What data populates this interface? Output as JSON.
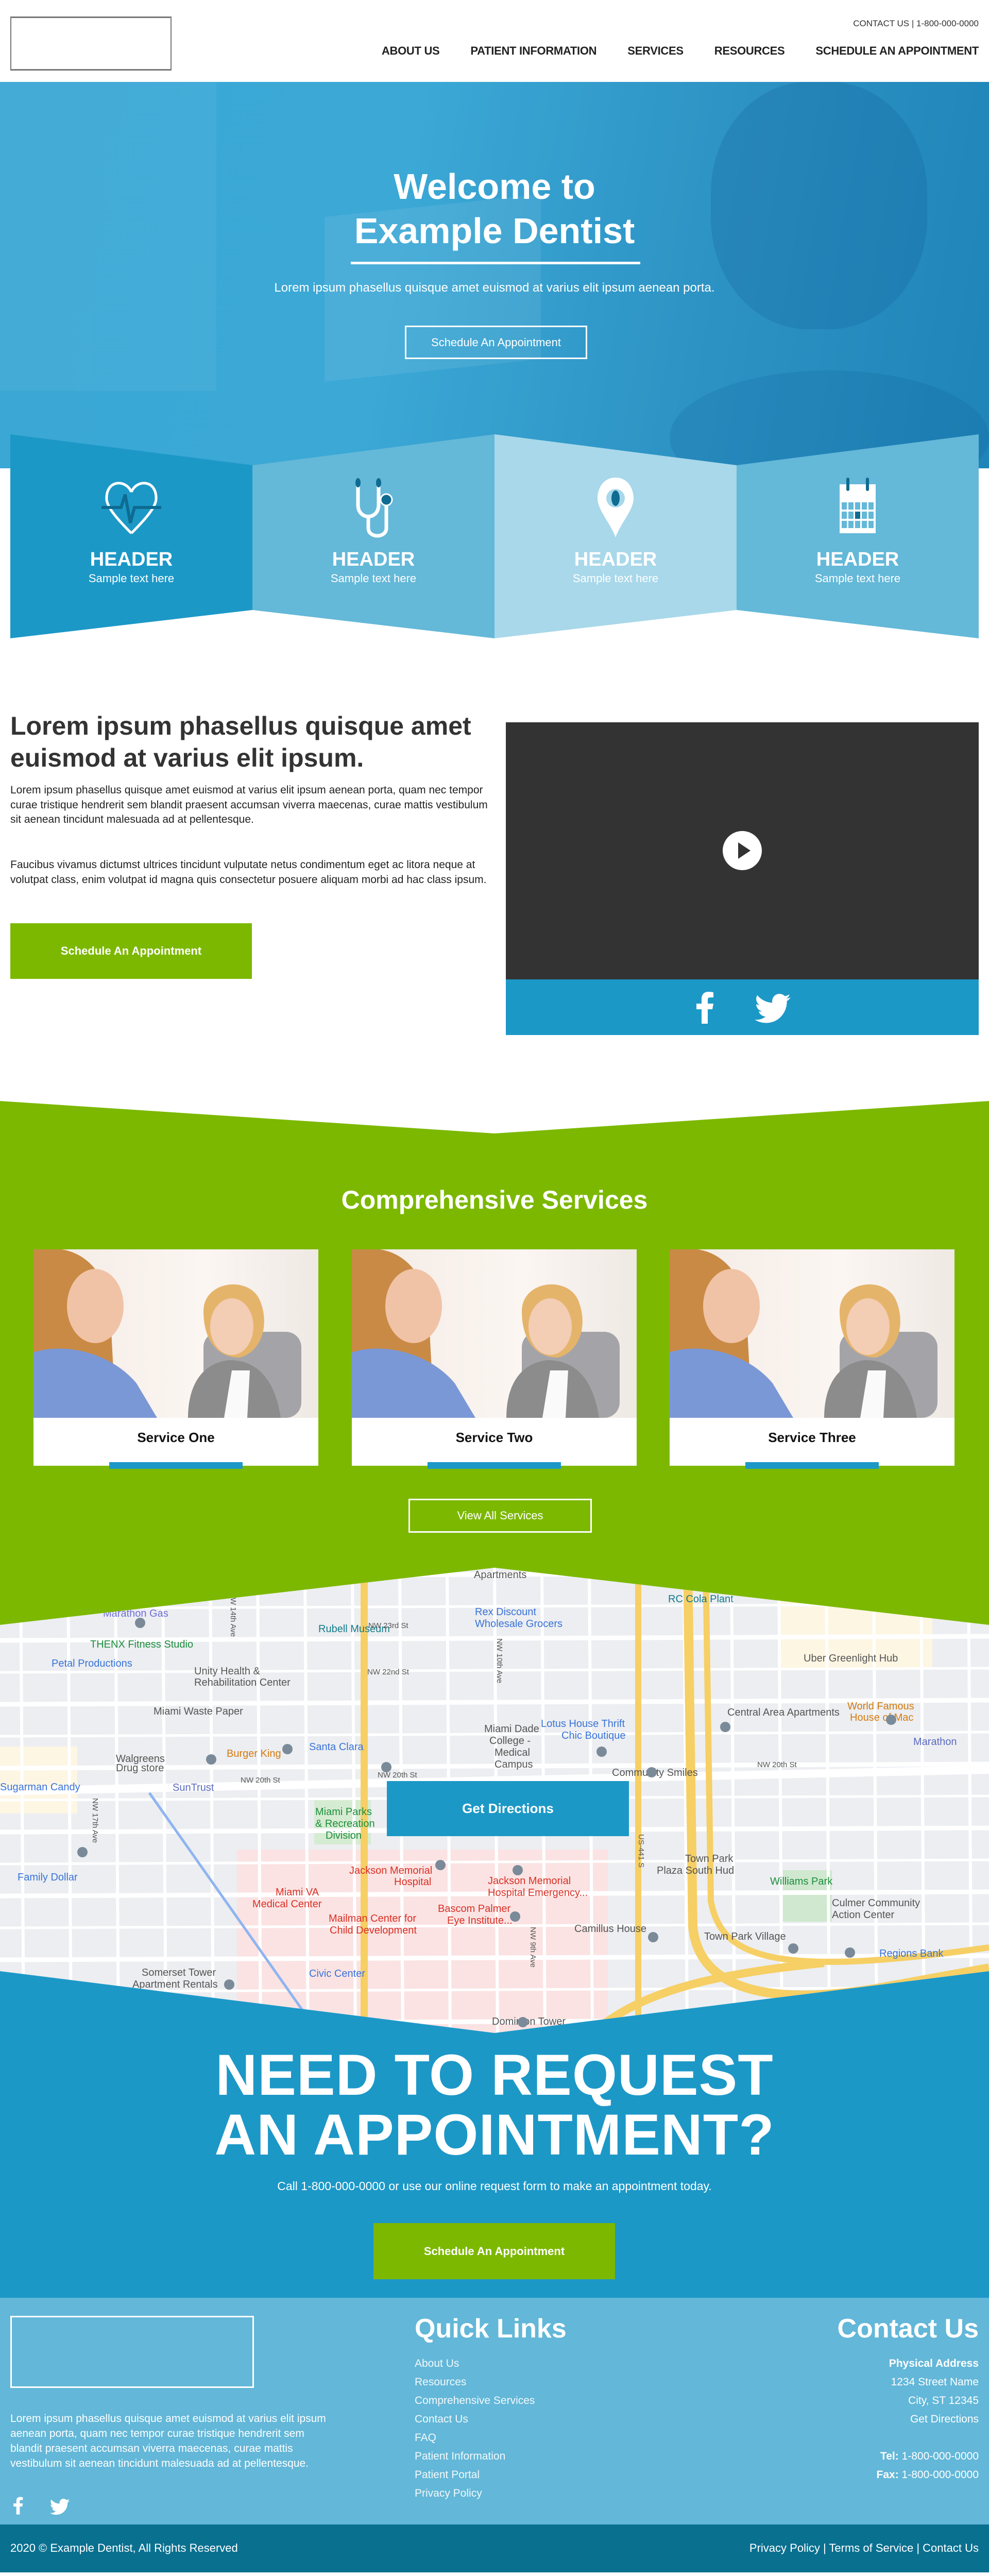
{
  "header": {
    "contact_link": "CONTACT US",
    "phone": "1-800-000-0000",
    "nav": [
      "ABOUT US",
      "PATIENT INFORMATION",
      "SERVICES",
      "RESOURCES",
      "SCHEDULE AN APPOINTMENT"
    ]
  },
  "hero": {
    "title_line1": "Welcome to",
    "title_line2": "Example Dentist",
    "subtitle": "Lorem ipsum phasellus quisque amet euismod at varius elit ipsum aenean porta.",
    "button": "Schedule An Appointment"
  },
  "features": [
    {
      "icon": "heartbeat-icon",
      "header": "HEADER",
      "text": "Sample text here",
      "color": "#1c98c7"
    },
    {
      "icon": "stethoscope-icon",
      "header": "HEADER",
      "text": "Sample text here",
      "color": "#64b8d8"
    },
    {
      "icon": "map-pin-icon",
      "header": "HEADER",
      "text": "Sample text here",
      "color": "#a8d8ea"
    },
    {
      "icon": "calendar-icon",
      "header": "HEADER",
      "text": "Sample text here",
      "color": "#64b8d8"
    }
  ],
  "intro": {
    "heading": "Lorem ipsum phasellus quisque amet euismod at varius elit ipsum.",
    "para1": "Lorem ipsum phasellus quisque amet euismod at varius elit ipsum aenean porta, quam nec tempor curae tristique hendrerit sem blandit praesent accumsan viverra maecenas, curae mattis vestibulum sit aenean tincidunt malesuada ad at pellentesque.",
    "para2": "Faucibus vivamus dictumst ultrices tincidunt vulputate netus condimentum eget ac litora neque at volutpat class, enim volutpat id magna quis consectetur posuere aliquam morbi ad hac class ipsum.",
    "button": "Schedule An Appointment"
  },
  "services": {
    "title": "Comprehensive Services",
    "cards": [
      "Service One",
      "Service Two",
      "Service Three"
    ],
    "button": "View All Services"
  },
  "map": {
    "button": "Get Directions",
    "labels": [
      "Apartments",
      "Marathon Gas",
      "THENX Fitness Studio",
      "Petal Productions",
      "Unity Health &",
      "Rehabilitation Center",
      "Rubell Museum",
      "Rex Discount",
      "Wholesale Grocers",
      "RC Cola Plant",
      "Uber Greenlight Hub",
      "Miami Waste Paper",
      "Burger King",
      "Santa Clara",
      "Miami Dade",
      "College -",
      "Medical",
      "Campus",
      "Lotus House Thrift",
      "Chic Boutique",
      "Central Area Apartments",
      "World Famous",
      "House of Mac",
      "Walgreens",
      "Drug store",
      "SunTrust",
      "Community Smiles",
      "Sugarman Candy",
      "Miami Parks",
      "& Recreation",
      "Division",
      "Jackson Memorial",
      "Hospital",
      "Miami VA",
      "Medical Center",
      "Jackson Memorial",
      "Hospital Emergency...",
      "Bascom Palmer",
      "Eye Institute...",
      "Mailman Center for",
      "Child Development",
      "Town Park",
      "Plaza South Hud",
      "Williams Park",
      "Culmer Community",
      "Action Center",
      "Camillus House",
      "Town Park Village",
      "Regions Bank",
      "Family Dollar",
      "Civic Center",
      "Somerset Tower",
      "Apartment Rentals",
      "Dominion Tower",
      "Marathon",
      "NW 20th St",
      "NW 20th St",
      "NW 20th St",
      "NW 22nd St",
      "NW 23rd St",
      "NW 10th Ave",
      "NW 14th Ave",
      "US-441 S",
      "NW 17th Ave",
      "NW 9th Ave"
    ]
  },
  "cta": {
    "title_line1": "NEED TO REQUEST",
    "title_line2": "AN APPOINTMENT?",
    "subtitle": "Call 1-800-000-0000 or use our online request form to make an appointment today.",
    "button": "Schedule An Appointment"
  },
  "footer": {
    "about": "Lorem ipsum phasellus quisque amet euismod at varius elit ipsum aenean porta, quam nec tempor curae tristique hendrerit sem blandit praesent accumsan viverra maecenas, curae mattis vestibulum sit aenean tincidunt malesuada ad at pellentesque.",
    "quick_links_title": "Quick Links",
    "quick_links": [
      "About Us",
      "Resources",
      "Comprehensive Services",
      "Contact Us",
      "FAQ",
      "Patient Information",
      "Patient Portal",
      "Privacy Policy"
    ],
    "contact_title": "Contact Us",
    "address_label": "Physical Address",
    "street": "1234 Street Name",
    "city": "City, ST 12345",
    "directions": "Get Directions",
    "tel_label": "Tel:",
    "tel": "1-800-000-0000",
    "fax_label": "Fax:",
    "fax": "1-800-000-0000",
    "copyright": "2020  © Example Dentist, All Rights Reserved",
    "legal": [
      "Privacy Policy",
      "Terms of Service",
      "Contact Us"
    ]
  },
  "colors": {
    "blue": "#1c98c7",
    "light_blue": "#63b7d8",
    "green": "#7cb800",
    "dark_blue": "#0a7090",
    "dark": "#333333"
  }
}
